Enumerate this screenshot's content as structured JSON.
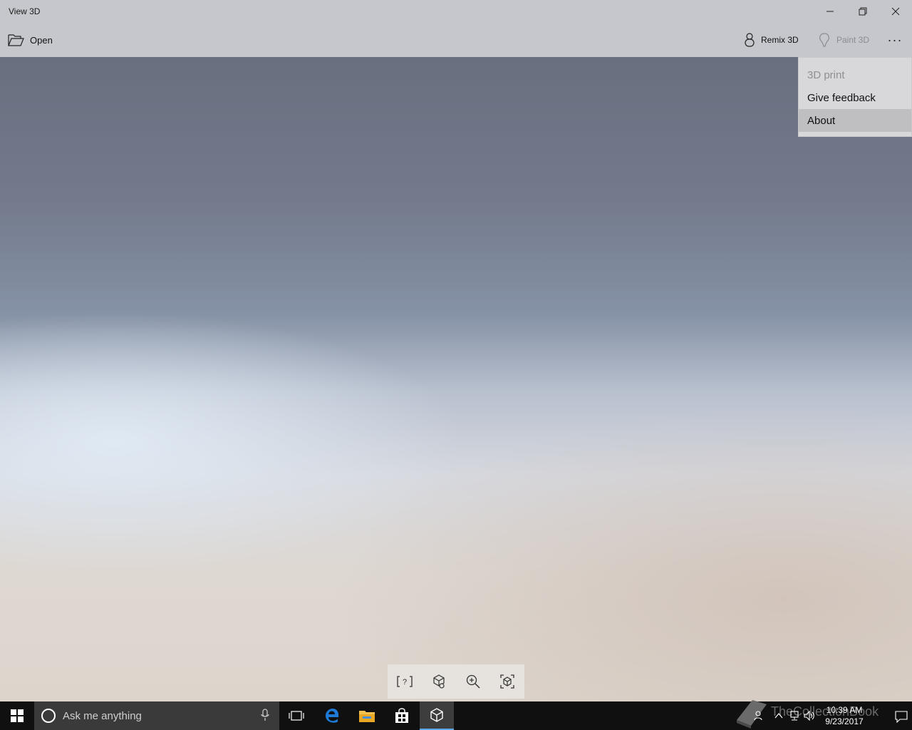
{
  "window": {
    "title": "View 3D",
    "minimize_glyph": "—",
    "maximize_glyph": "❐",
    "close_glyph": "✕"
  },
  "commandbar": {
    "open_label": "Open",
    "remix_label": "Remix 3D",
    "paint_label": "Paint 3D",
    "more_glyph": "···"
  },
  "menu": {
    "items": [
      {
        "label": "3D print",
        "state": "disabled"
      },
      {
        "label": "Give feedback",
        "state": "normal"
      },
      {
        "label": "About",
        "state": "hover"
      }
    ]
  },
  "viewer_toolbar": {
    "buttons": [
      "help-icon",
      "environment-icon",
      "zoom-in-icon",
      "reset-view-icon"
    ]
  },
  "taskbar": {
    "search_placeholder": "Ask me anything",
    "time": "10:39 AM",
    "date": "9/23/2017",
    "watermark": "TheCollectionBook",
    "accent_color": "#5da8e6"
  }
}
